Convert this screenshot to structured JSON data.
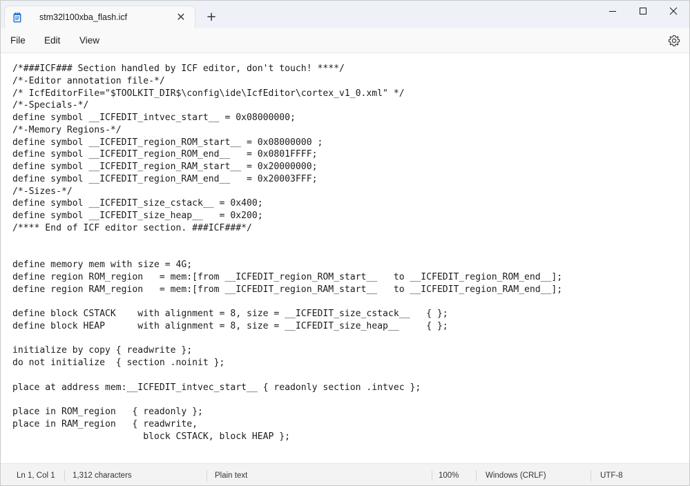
{
  "window": {
    "tab_title": "stm32l100xba_flash.icf",
    "tab_close_glyph": "✕",
    "new_tab_glyph": "+",
    "icons": [
      "notepad-icon",
      "close-icon",
      "plus-icon",
      "minimize-icon",
      "maximize-icon",
      "close-window-icon",
      "gear-icon"
    ]
  },
  "menu": {
    "file": "File",
    "edit": "Edit",
    "view": "View"
  },
  "editor": {
    "lines": [
      "/*###ICF### Section handled by ICF editor, don't touch! ****/",
      "/*-Editor annotation file-*/",
      "/* IcfEditorFile=\"$TOOLKIT_DIR$\\config\\ide\\IcfEditor\\cortex_v1_0.xml\" */",
      "/*-Specials-*/",
      "define symbol __ICFEDIT_intvec_start__ = 0x08000000;",
      "/*-Memory Regions-*/",
      "define symbol __ICFEDIT_region_ROM_start__ = 0x08000000 ;",
      "define symbol __ICFEDIT_region_ROM_end__   = 0x0801FFFF;",
      "define symbol __ICFEDIT_region_RAM_start__ = 0x20000000;",
      "define symbol __ICFEDIT_region_RAM_end__   = 0x20003FFF;",
      "/*-Sizes-*/",
      "define symbol __ICFEDIT_size_cstack__ = 0x400;",
      "define symbol __ICFEDIT_size_heap__   = 0x200;",
      "/**** End of ICF editor section. ###ICF###*/",
      "",
      "",
      "define memory mem with size = 4G;",
      "define region ROM_region   = mem:[from __ICFEDIT_region_ROM_start__   to __ICFEDIT_region_ROM_end__];",
      "define region RAM_region   = mem:[from __ICFEDIT_region_RAM_start__   to __ICFEDIT_region_RAM_end__];",
      "",
      "define block CSTACK    with alignment = 8, size = __ICFEDIT_size_cstack__   { };",
      "define block HEAP      with alignment = 8, size = __ICFEDIT_size_heap__     { };",
      "",
      "initialize by copy { readwrite };",
      "do not initialize  { section .noinit };",
      "",
      "place at address mem:__ICFEDIT_intvec_start__ { readonly section .intvec };",
      "",
      "place in ROM_region   { readonly };",
      "place in RAM_region   { readwrite,",
      "                        block CSTACK, block HEAP };"
    ]
  },
  "status": {
    "position": "Ln 1, Col 1",
    "characters": "1,312 characters",
    "format": "Plain text",
    "zoom": "100%",
    "line_ending": "Windows (CRLF)",
    "encoding": "UTF-8"
  }
}
